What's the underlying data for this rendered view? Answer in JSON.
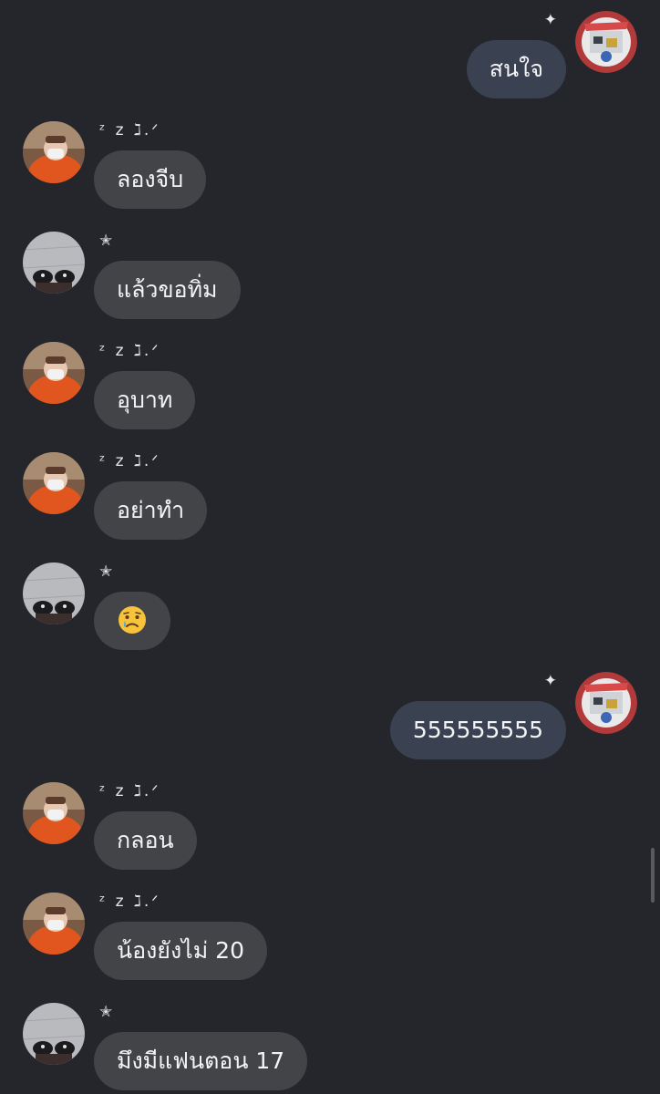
{
  "colors": {
    "background": "#25262b",
    "incoming_bubble": "#434448",
    "outgoing_bubble": "#3a4151",
    "text": "#f4f4f6"
  },
  "messages": [
    {
      "side": "right",
      "sender": "✦",
      "text": "สนใจ",
      "avatar": "sticker-avatar"
    },
    {
      "side": "left",
      "sender": "ᶻ z ℷ.ᐟ",
      "text": "ลองจีบ",
      "avatar": "masked-person-avatar"
    },
    {
      "side": "left",
      "sender": "✭",
      "text": "แล้วขอทิ่ม",
      "avatar": "shoes-avatar"
    },
    {
      "side": "left",
      "sender": "ᶻ z ℷ.ᐟ",
      "text": "อุบาท",
      "avatar": "masked-person-avatar"
    },
    {
      "side": "left",
      "sender": "ᶻ z ℷ.ᐟ",
      "text": "อย่าทำ",
      "avatar": "masked-person-avatar"
    },
    {
      "side": "left",
      "sender": "✭",
      "text": "",
      "emoji": "crying-face-emoji",
      "avatar": "shoes-avatar"
    },
    {
      "side": "right",
      "sender": "✦",
      "text": "555555555",
      "avatar": "sticker-avatar"
    },
    {
      "side": "left",
      "sender": "ᶻ z ℷ.ᐟ",
      "text": "กลอน",
      "avatar": "masked-person-avatar"
    },
    {
      "side": "left",
      "sender": "ᶻ z ℷ.ᐟ",
      "text": "น้องยังไม่ 20",
      "avatar": "masked-person-avatar"
    },
    {
      "side": "left",
      "sender": "✭",
      "text": "มึงมีแฟนตอน 17",
      "avatar": "shoes-avatar"
    }
  ]
}
